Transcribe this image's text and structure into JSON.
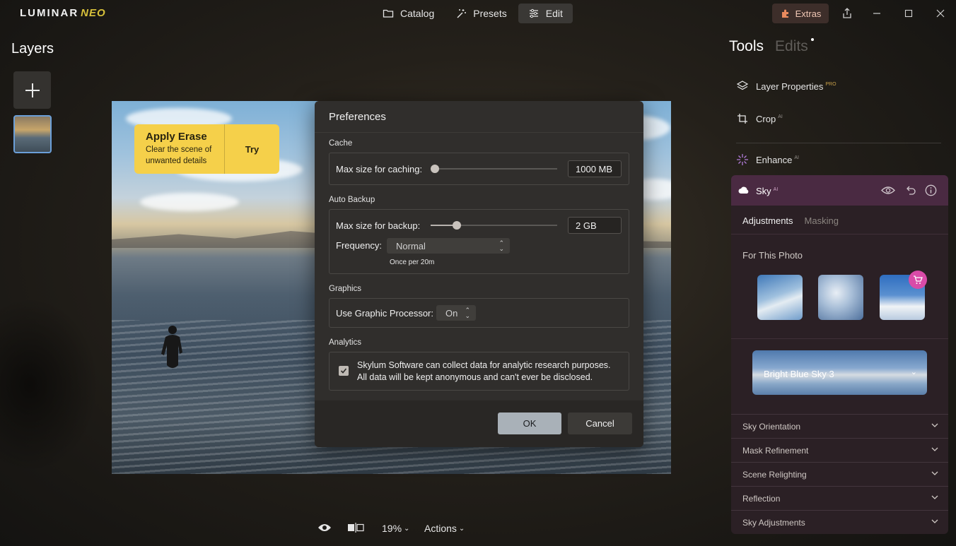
{
  "app": {
    "logo_main": "LUMINAR",
    "logo_neo": "NEO"
  },
  "modes": [
    {
      "label": "Catalog",
      "icon": "folder-icon",
      "active": false
    },
    {
      "label": "Presets",
      "icon": "magic-wand-icon",
      "active": false
    },
    {
      "label": "Edit",
      "icon": "sliders-icon",
      "active": true
    }
  ],
  "header": {
    "extras_label": "Extras"
  },
  "layers": {
    "title": "Layers",
    "add_icon": "plus-icon"
  },
  "erase_card": {
    "title": "Apply Erase",
    "description": "Clear the scene of unwanted details",
    "try_label": "Try"
  },
  "preferences": {
    "title": "Preferences",
    "cache": {
      "section": "Cache",
      "label": "Max size for caching:",
      "value": "1000 MB",
      "slider_fraction": 0.0
    },
    "backup": {
      "section": "Auto Backup",
      "label": "Max size for backup:",
      "value": "2 GB",
      "slider_fraction": 0.2,
      "frequency_label": "Frequency:",
      "frequency_value": "Normal",
      "frequency_hint": "Once per 20m"
    },
    "graphics": {
      "section": "Graphics",
      "label": "Use Graphic Processor:",
      "value": "On"
    },
    "analytics": {
      "section": "Analytics",
      "checked": true,
      "line1": "Skylum Software can collect data for analytic research purposes.",
      "line2": "All data will be kept anonymous and can't ever be disclosed."
    },
    "ok_label": "OK",
    "cancel_label": "Cancel"
  },
  "bottom_bar": {
    "zoom": "19%",
    "actions_label": "Actions"
  },
  "right_panel": {
    "tab_tools": "Tools",
    "tab_edits": "Edits",
    "tools": [
      {
        "label": "Layer Properties",
        "badge": "PRO",
        "icon": "layers-icon"
      },
      {
        "label": "Crop",
        "badge": "AI",
        "icon": "crop-icon"
      },
      {
        "label": "Enhance",
        "badge": "AI",
        "icon": "sparkle-icon"
      }
    ],
    "sky": {
      "title": "Sky",
      "badge": "AI",
      "subtab_adjustments": "Adjustments",
      "subtab_masking": "Masking",
      "for_this_photo": "For This Photo",
      "selected_sky": "Bright Blue Sky 3",
      "sections": [
        "Sky Orientation",
        "Mask Refinement",
        "Scene Relighting",
        "Reflection",
        "Sky Adjustments"
      ]
    }
  },
  "colors": {
    "accent_yellow": "#f5d04a",
    "sky_header": "#4a2a42",
    "layer_selected_border": "#6b9fd8",
    "cart_badge": "#d94ba8"
  }
}
